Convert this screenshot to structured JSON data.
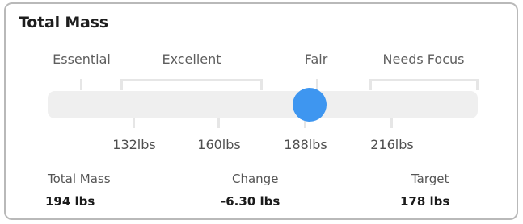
{
  "card": {
    "title": "Total Mass"
  },
  "scale": {
    "categories": [
      "Essential",
      "Excellent",
      "Fair",
      "Needs Focus"
    ],
    "weight_ticks": [
      "132lbs",
      "160lbs",
      "188lbs",
      "216lbs"
    ],
    "current_value_lbs": 194,
    "knob_color": "#3e96f0",
    "track_color": "#efefef"
  },
  "stats": {
    "total_mass_label": "Total Mass",
    "total_mass_value": "194 lbs",
    "change_label": "Change",
    "change_value": "-6.30 lbs",
    "target_label": "Target",
    "target_value": "178 lbs"
  }
}
